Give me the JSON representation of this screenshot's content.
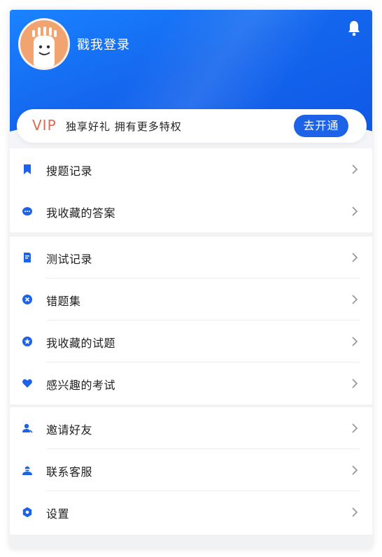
{
  "profile": {
    "login_text": "戳我登录"
  },
  "vip": {
    "label": "VIP",
    "subtitle": "独享好礼 拥有更多特权",
    "button": "去开通"
  },
  "colors": {
    "accent": "#1d63e8",
    "vip": "#e06a4a",
    "header": "#1466ee"
  },
  "groups": [
    {
      "items": [
        {
          "label": "搜题记录",
          "icon": "bookmark-icon"
        },
        {
          "label": "我收藏的答案",
          "icon": "chat-bubble-icon"
        }
      ]
    },
    {
      "items": [
        {
          "label": "测试记录",
          "icon": "document-edit-icon"
        },
        {
          "label": "错题集",
          "icon": "close-circle-icon"
        },
        {
          "label": "我收藏的试题",
          "icon": "star-circle-icon"
        },
        {
          "label": "感兴趣的考试",
          "icon": "heart-icon"
        }
      ]
    },
    {
      "items": [
        {
          "label": "邀请好友",
          "icon": "invite-user-icon"
        },
        {
          "label": "联系客服",
          "icon": "customer-service-icon"
        },
        {
          "label": "设置",
          "icon": "settings-icon"
        }
      ]
    }
  ]
}
